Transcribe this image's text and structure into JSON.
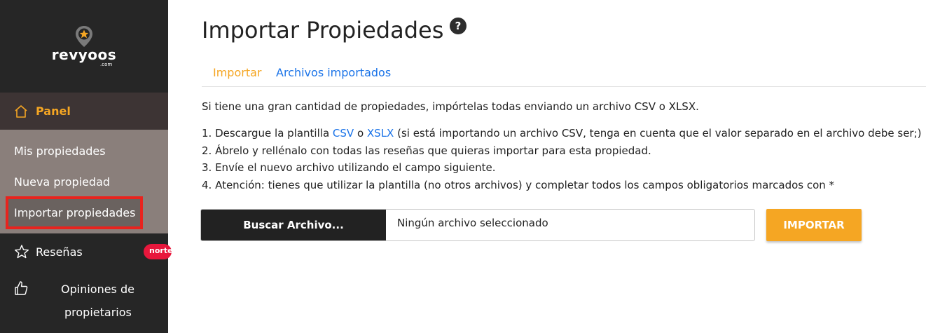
{
  "sidebar": {
    "logo": {
      "name": "revyoos",
      "sub": ".com"
    },
    "panel_label": "Panel",
    "items": [
      {
        "label": "Mis propiedades"
      },
      {
        "label": "Nueva propiedad"
      },
      {
        "label": "Importar propiedades"
      }
    ],
    "resenas_label": "Reseñas",
    "badge": "norte",
    "opiniones_line1": "Opiniones de",
    "opiniones_line2": "propietarios"
  },
  "main": {
    "title": "Importar Propiedades",
    "help": "?",
    "tabs": [
      {
        "label": "Importar"
      },
      {
        "label": "Archivos importados"
      }
    ],
    "intro": "Si tiene una gran cantidad de propiedades, impórtelas todas enviando un archivo CSV o XLSX.",
    "step1_prefix": "1. Descargue la plantilla ",
    "step1_csv": "CSV",
    "step1_mid": " o ",
    "step1_xlsx": "XSLX",
    "step1_suffix": " (si está importando un archivo CSV, tenga en cuenta que el valor separado en el archivo debe ser;)",
    "step2": "2. Ábrelo y rellénalo con todas las reseñas que quieras importar para esta propiedad.",
    "step3": "3. Envíe el nuevo archivo utilizando el campo siguiente.",
    "step4": "4. Atención: tienes que utilizar la plantilla (no otros archivos) y completar todos los campos obligatorios marcados con *",
    "browse_button": "Buscar Archivo...",
    "file_status": "Ningún archivo seleccionado",
    "import_button": "IMPORTAR"
  },
  "colors": {
    "accent": "#f5a623",
    "link": "#1a73e8",
    "highlight": "#e8231e"
  }
}
